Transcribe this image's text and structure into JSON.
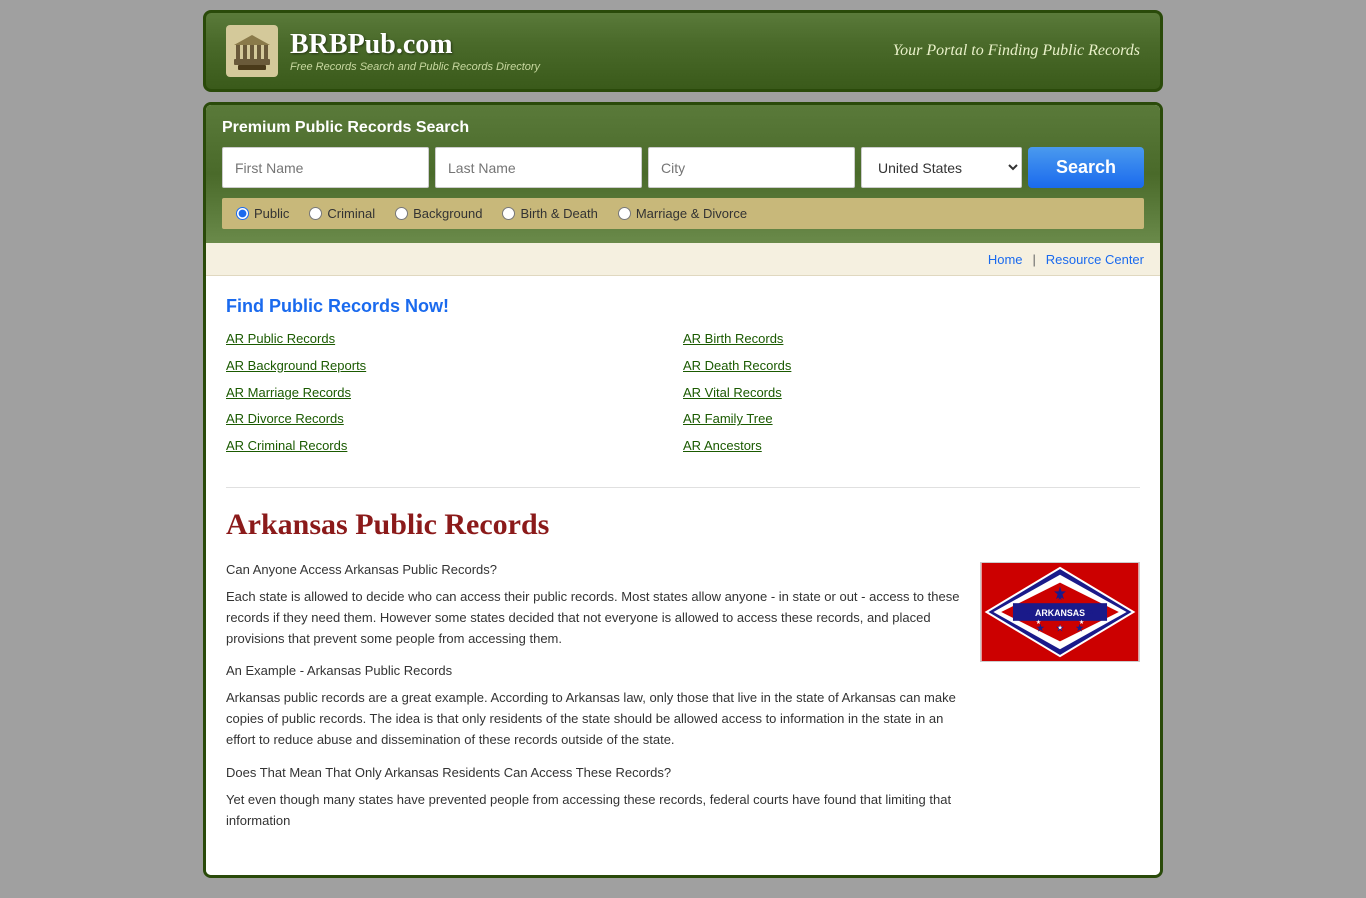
{
  "header": {
    "logo_title": "BRBPub.com",
    "logo_subtitle": "Free Records Search and Public Records Directory",
    "tagline": "Your Portal to Finding Public Records"
  },
  "search": {
    "section_title": "Premium Public Records Search",
    "first_name_placeholder": "First Name",
    "last_name_placeholder": "Last Name",
    "city_placeholder": "City",
    "country_value": "United States",
    "search_button_label": "Search",
    "radio_options": [
      {
        "id": "r-public",
        "label": "Public",
        "checked": true
      },
      {
        "id": "r-criminal",
        "label": "Criminal",
        "checked": false
      },
      {
        "id": "r-background",
        "label": "Background",
        "checked": false
      },
      {
        "id": "r-birthdeath",
        "label": "Birth & Death",
        "checked": false
      },
      {
        "id": "r-marriage",
        "label": "Marriage & Divorce",
        "checked": false
      }
    ]
  },
  "breadcrumb": {
    "home": "Home",
    "separator": "|",
    "resource_center": "Resource Center"
  },
  "find_records": {
    "title": "Find Public Records Now!",
    "col1": [
      {
        "label": "AR Public Records",
        "href": "#"
      },
      {
        "label": "AR Background Reports",
        "href": "#"
      },
      {
        "label": "AR Marriage Records",
        "href": "#"
      },
      {
        "label": "AR Divorce Records",
        "href": "#"
      },
      {
        "label": "AR Criminal Records",
        "href": "#"
      }
    ],
    "col2": [
      {
        "label": "AR Birth Records",
        "href": "#"
      },
      {
        "label": "AR Death Records",
        "href": "#"
      },
      {
        "label": "AR Vital Records",
        "href": "#"
      },
      {
        "label": "AR Family Tree",
        "href": "#"
      },
      {
        "label": "AR Ancestors",
        "href": "#"
      }
    ]
  },
  "main_content": {
    "heading": "Arkansas Public Records",
    "question1": "Can Anyone Access Arkansas Public Records?",
    "paragraph1": "Each state is allowed to decide who can access their public records. Most states allow anyone - in state or out - access to these records if they need them. However some states decided that not everyone is allowed to access these records, and placed provisions that prevent some people from accessing them.",
    "subheading": "An Example - Arkansas Public Records",
    "paragraph2": "Arkansas public records are a great example. According to Arkansas law, only those that live in the state of Arkansas can make copies of public records. The idea is that only residents of the state should be allowed access to information in the state in an effort to reduce abuse and dissemination of these records outside of the state.",
    "question2": "Does That Mean That Only Arkansas Residents Can Access These Records?",
    "paragraph3": "Yet even though many states have prevented people from accessing these records, federal courts have found that limiting that information"
  }
}
